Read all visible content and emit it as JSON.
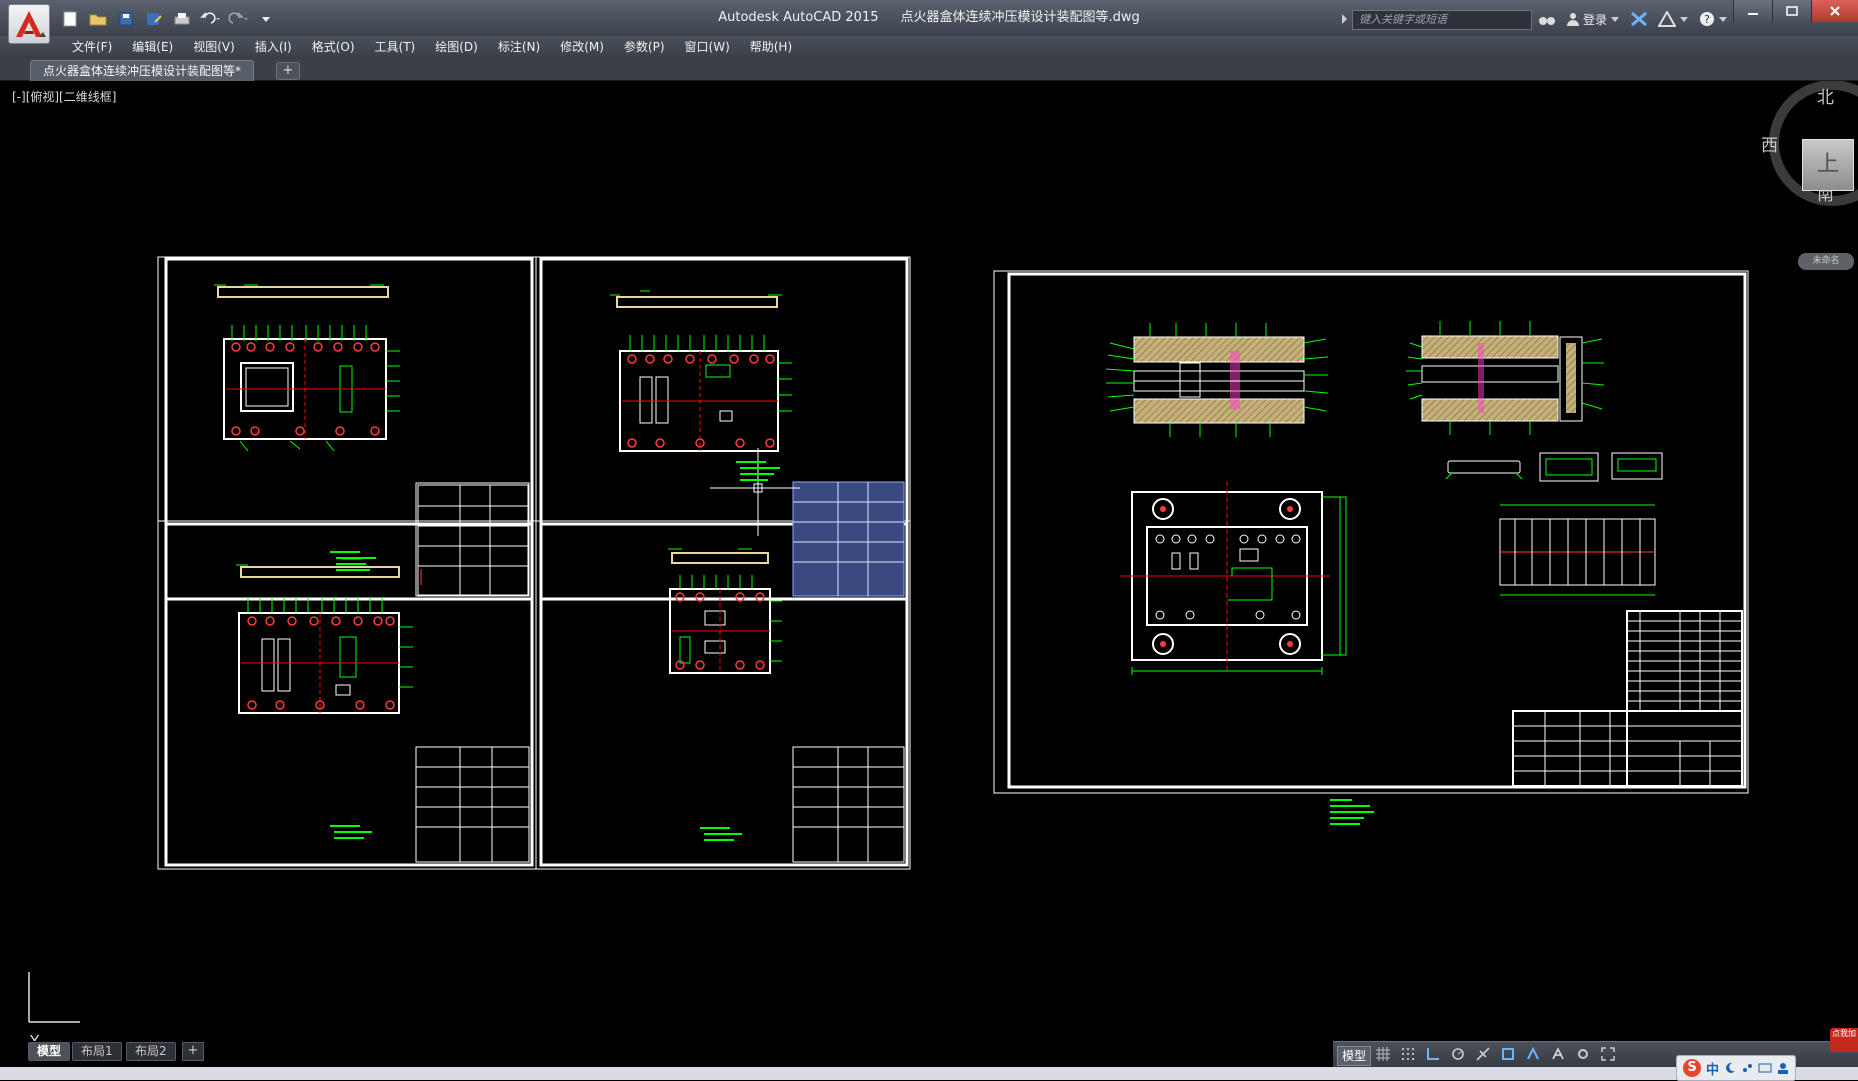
{
  "titlebar": {
    "app_name": "Autodesk AutoCAD 2015",
    "file_name": "点火器盒体连续冲压模设计装配图等.dwg",
    "search_placeholder": "键入关键字或短语",
    "login_label": "登录"
  },
  "menu": {
    "items": [
      {
        "label": "文件(F)"
      },
      {
        "label": "编辑(E)"
      },
      {
        "label": "视图(V)"
      },
      {
        "label": "插入(I)"
      },
      {
        "label": "格式(O)"
      },
      {
        "label": "工具(T)"
      },
      {
        "label": "绘图(D)"
      },
      {
        "label": "标注(N)"
      },
      {
        "label": "修改(M)"
      },
      {
        "label": "参数(P)"
      },
      {
        "label": "窗口(W)"
      },
      {
        "label": "帮助(H)"
      }
    ]
  },
  "document_tab": {
    "label": "点火器盒体连续冲压模设计装配图等*",
    "new_tab": "+"
  },
  "viewport": {
    "label": "[-][俯视][二维线框]"
  },
  "viewcube": {
    "north": "北",
    "south": "南",
    "west": "西",
    "face": "上",
    "wcs_label": "未命名"
  },
  "ucs": {
    "x_label": "X",
    "y_label": "Y"
  },
  "layout_tabs": {
    "items": [
      {
        "label": "模型"
      },
      {
        "label": "布局1"
      },
      {
        "label": "布局2"
      }
    ],
    "add": "+"
  },
  "statusbar": {
    "model_label": "模型",
    "icons": [
      "grid-icon",
      "snap-icon",
      "ortho-icon",
      "polar-icon",
      "osnap-icon",
      "otrack-icon",
      "annotation-icon",
      "workspace-icon",
      "settings-icon",
      "fullscreen-icon"
    ]
  },
  "taskbar": {
    "ime_zh": "中",
    "notify_text": "点我加"
  },
  "colors": {
    "titlebar": "#4a505a",
    "canvas": "#000000",
    "cad_white": "#ffffff",
    "cad_green": "#00ff00",
    "cad_red": "#ff0000",
    "cad_yellow": "#e8d8a0"
  }
}
